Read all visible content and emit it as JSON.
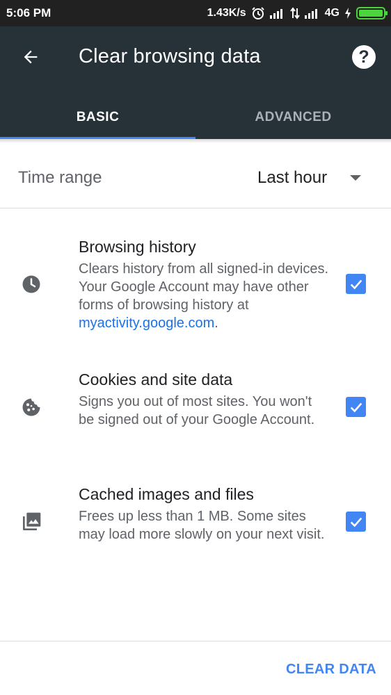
{
  "status_bar": {
    "time": "5:06 PM",
    "net_speed": "1.43K/s",
    "network": "4G",
    "icons": [
      "alarm-icon",
      "signal-icon",
      "data-arrows-icon",
      "signal-icon",
      "charging-icon",
      "battery-icon"
    ]
  },
  "app_bar": {
    "title": "Clear browsing data",
    "help": "?",
    "tabs": [
      {
        "label": "BASIC",
        "active": true
      },
      {
        "label": "ADVANCED",
        "active": false
      }
    ],
    "accent": "#4285f4"
  },
  "time_range": {
    "label": "Time range",
    "value": "Last hour"
  },
  "options": [
    {
      "title": "Browsing history",
      "desc_text": "Clears history from all signed-in devices. Your Google Account may have other forms of browsing history at ",
      "desc_link": "myactivity.google.com",
      "desc_tail": ".",
      "checked": true,
      "icon": "clock-icon"
    },
    {
      "title": "Cookies and site data",
      "desc_text": "Signs you out of most sites. You won't be signed out of your Google Account.",
      "checked": true,
      "icon": "cookie-icon"
    },
    {
      "title": "Cached images and files",
      "desc_text": "Frees up less than 1 MB. Some sites may load more slowly on your next visit.",
      "checked": true,
      "icon": "images-icon"
    }
  ],
  "footer": {
    "button": "CLEAR DATA"
  }
}
